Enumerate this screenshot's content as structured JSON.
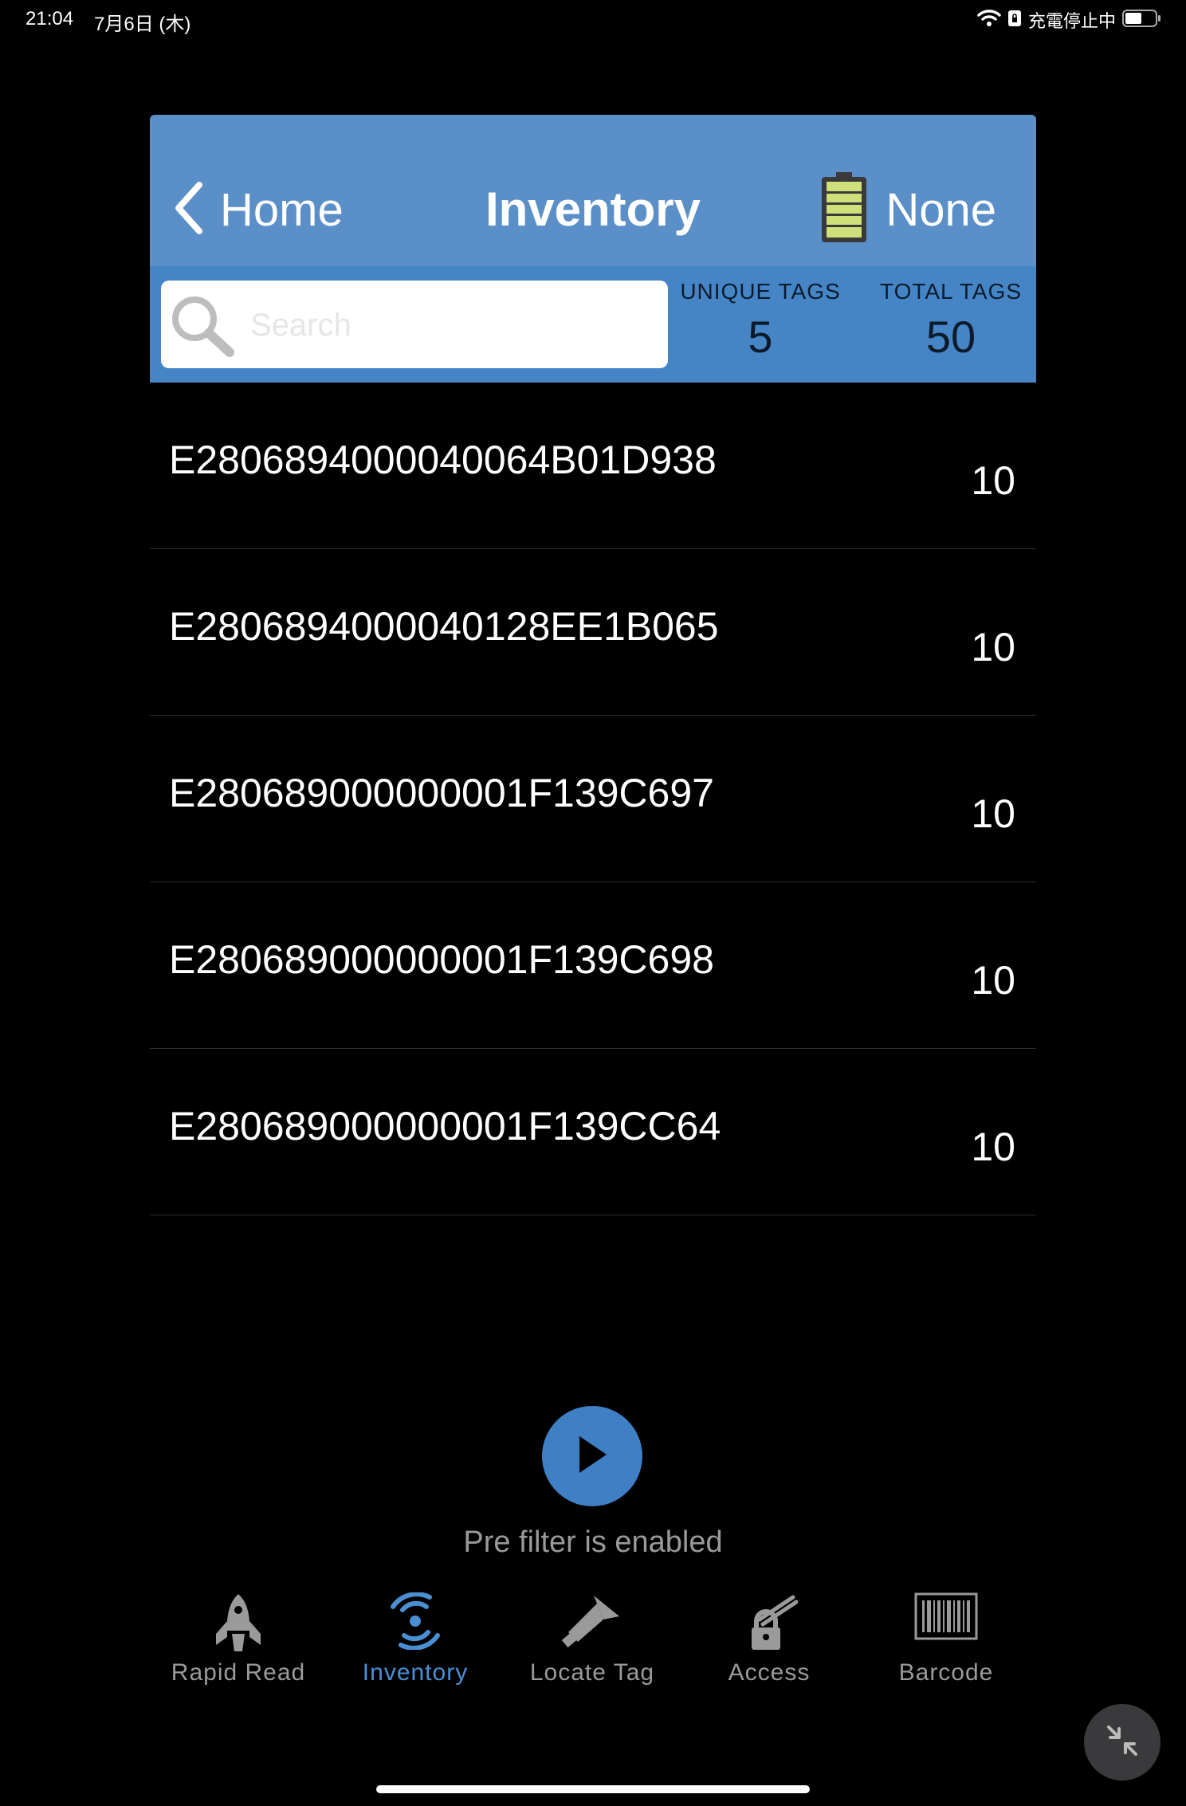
{
  "status_bar": {
    "time": "21:04",
    "date": "7月6日 (木)",
    "charging_text": "充電停止中",
    "icons": [
      "wifi-icon",
      "lock-rotation-icon",
      "battery-icon"
    ]
  },
  "header": {
    "back_label": "Home",
    "title": "Inventory",
    "device_name": "None",
    "icons": [
      "chevron-left-icon",
      "reader-battery-icon"
    ]
  },
  "search": {
    "placeholder": "Search",
    "value": ""
  },
  "counters": {
    "unique_label": "UNIQUE TAGS",
    "unique_value": "5",
    "total_label": "TOTAL TAGS",
    "total_value": "50"
  },
  "tags": [
    {
      "id": "E2806894000040064B01D938",
      "count": "10"
    },
    {
      "id": "E2806894000040128EE1B065",
      "count": "10"
    },
    {
      "id": "E280689000000001F139C697",
      "count": "10"
    },
    {
      "id": "E280689000000001F139C698",
      "count": "10"
    },
    {
      "id": "E280689000000001F139CC64",
      "count": "10"
    }
  ],
  "controls": {
    "prefilter_text": "Pre filter is enabled",
    "play_icon": "play-icon"
  },
  "tabs": [
    {
      "label": "Rapid Read",
      "icon": "rocket-icon",
      "active": false
    },
    {
      "label": "Inventory",
      "icon": "antenna-icon",
      "active": true
    },
    {
      "label": "Locate Tag",
      "icon": "flashlight-icon",
      "active": false
    },
    {
      "label": "Access",
      "icon": "lock-icon",
      "active": false
    },
    {
      "label": "Barcode",
      "icon": "barcode-icon",
      "active": false
    }
  ],
  "colors": {
    "header_bg": "#5a8fc7",
    "filter_bar_bg": "#4585c6",
    "accent": "#3f7fc4",
    "active_tab": "#4a8fd4",
    "inactive_tab": "#9a9a9a",
    "background": "#000000"
  }
}
